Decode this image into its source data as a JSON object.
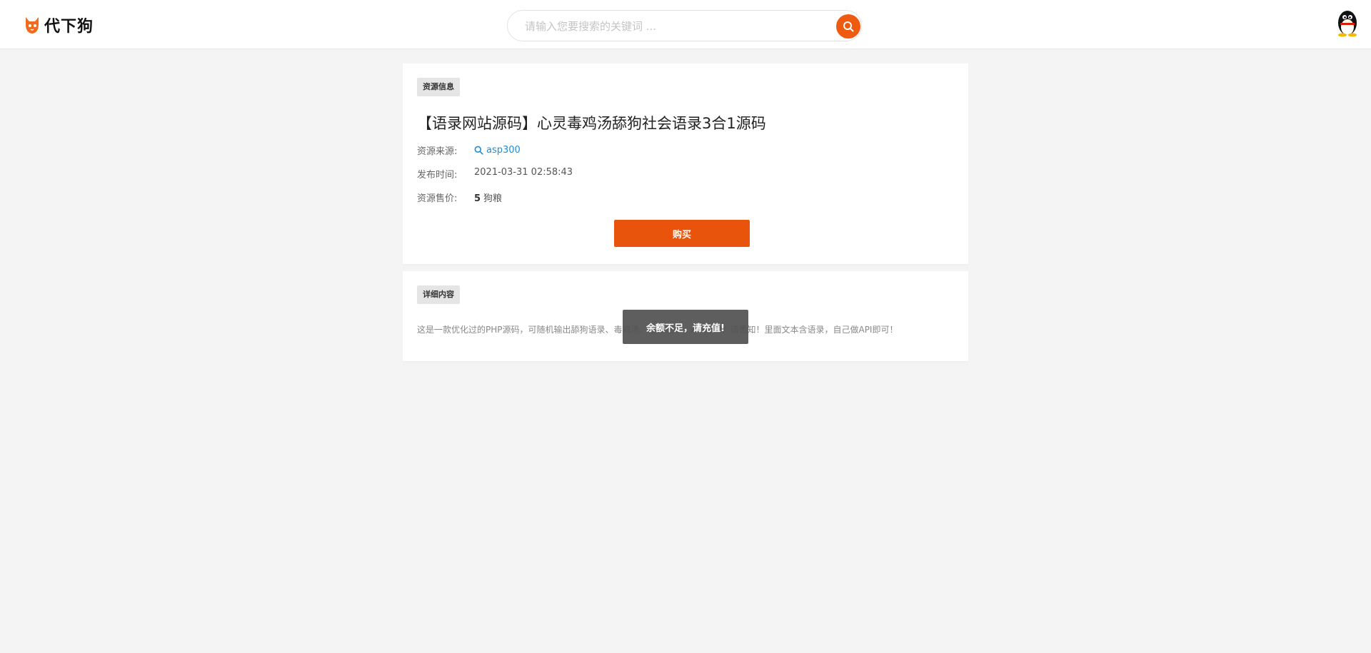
{
  "header": {
    "logo_text": "代下狗",
    "search": {
      "placeholder": "请输入您要搜索的关键词 ...",
      "value": ""
    }
  },
  "resource": {
    "section_label": "资源信息",
    "title": "【语录网站源码】心灵毒鸡汤舔狗社会语录3合1源码",
    "source_label": "资源来源:",
    "source_value": "asp300",
    "time_label": "发布时间:",
    "time_value": "2021-03-31 02:58:43",
    "price_label": "资源售价:",
    "price_amount": "5",
    "price_unit": "狗粮",
    "buy_label": "购买"
  },
  "detail": {
    "section_label": "详细内容",
    "text": "这是一款优化过的PHP源码，可随机输出舔狗语录、毒鸡汤、社会语录，API接口，请悉知！里面文本含语录，自己做API即可！"
  },
  "toast": {
    "message": "余额不足，请充值!"
  },
  "colors": {
    "accent": "#e8540c",
    "link": "#1f8dd6",
    "background": "#f4f4f4"
  },
  "icons": {
    "logo": "fox-logo-icon",
    "search": "search-icon",
    "source": "search-icon",
    "avatar": "penguin-avatar-icon"
  }
}
